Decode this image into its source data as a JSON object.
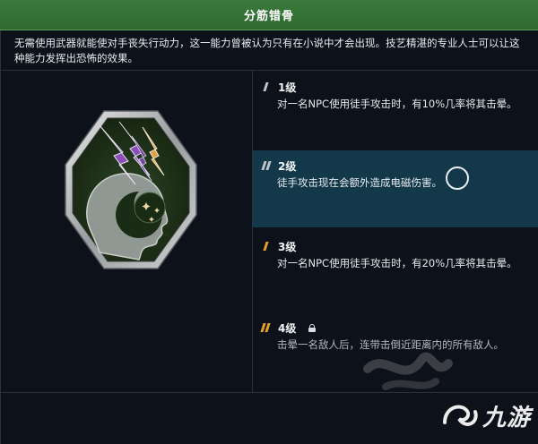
{
  "title": "分筋错骨",
  "description": "无需使用武器就能使对手丧失行动力，这一能力曾被认为只有在小说中才会出现。技艺精湛的专业人士可以让这种能力发挥出恐怖的效果。",
  "badge_icon": "psychic-head-lightning-icon",
  "colors": {
    "title_bg": "#2f6a31",
    "active_tier_bg": "#123849",
    "tier_mark_gray": "#bfc4c8",
    "tier_mark_orange": "#e7a12a",
    "badge_purple": "#8a4fb8",
    "badge_orange": "#d9a24a"
  },
  "tiers": [
    {
      "label": "1级",
      "desc": "对一名NPC使用徒手攻击时，有10%几率将其击晕。",
      "active": false,
      "locked": false
    },
    {
      "label": "2级",
      "desc": "徒手攻击现在会额外造成电磁伤害。",
      "active": true,
      "locked": false
    },
    {
      "label": "3级",
      "desc": "对一名NPC使用徒手攻击时，有20%几率将其击晕。",
      "active": false,
      "locked": false
    },
    {
      "label": "4级",
      "desc": "击晕一名敌人后，连带击倒近距离内的所有敌人。",
      "active": false,
      "locked": true
    }
  ],
  "watermark": {
    "text": "九游"
  }
}
